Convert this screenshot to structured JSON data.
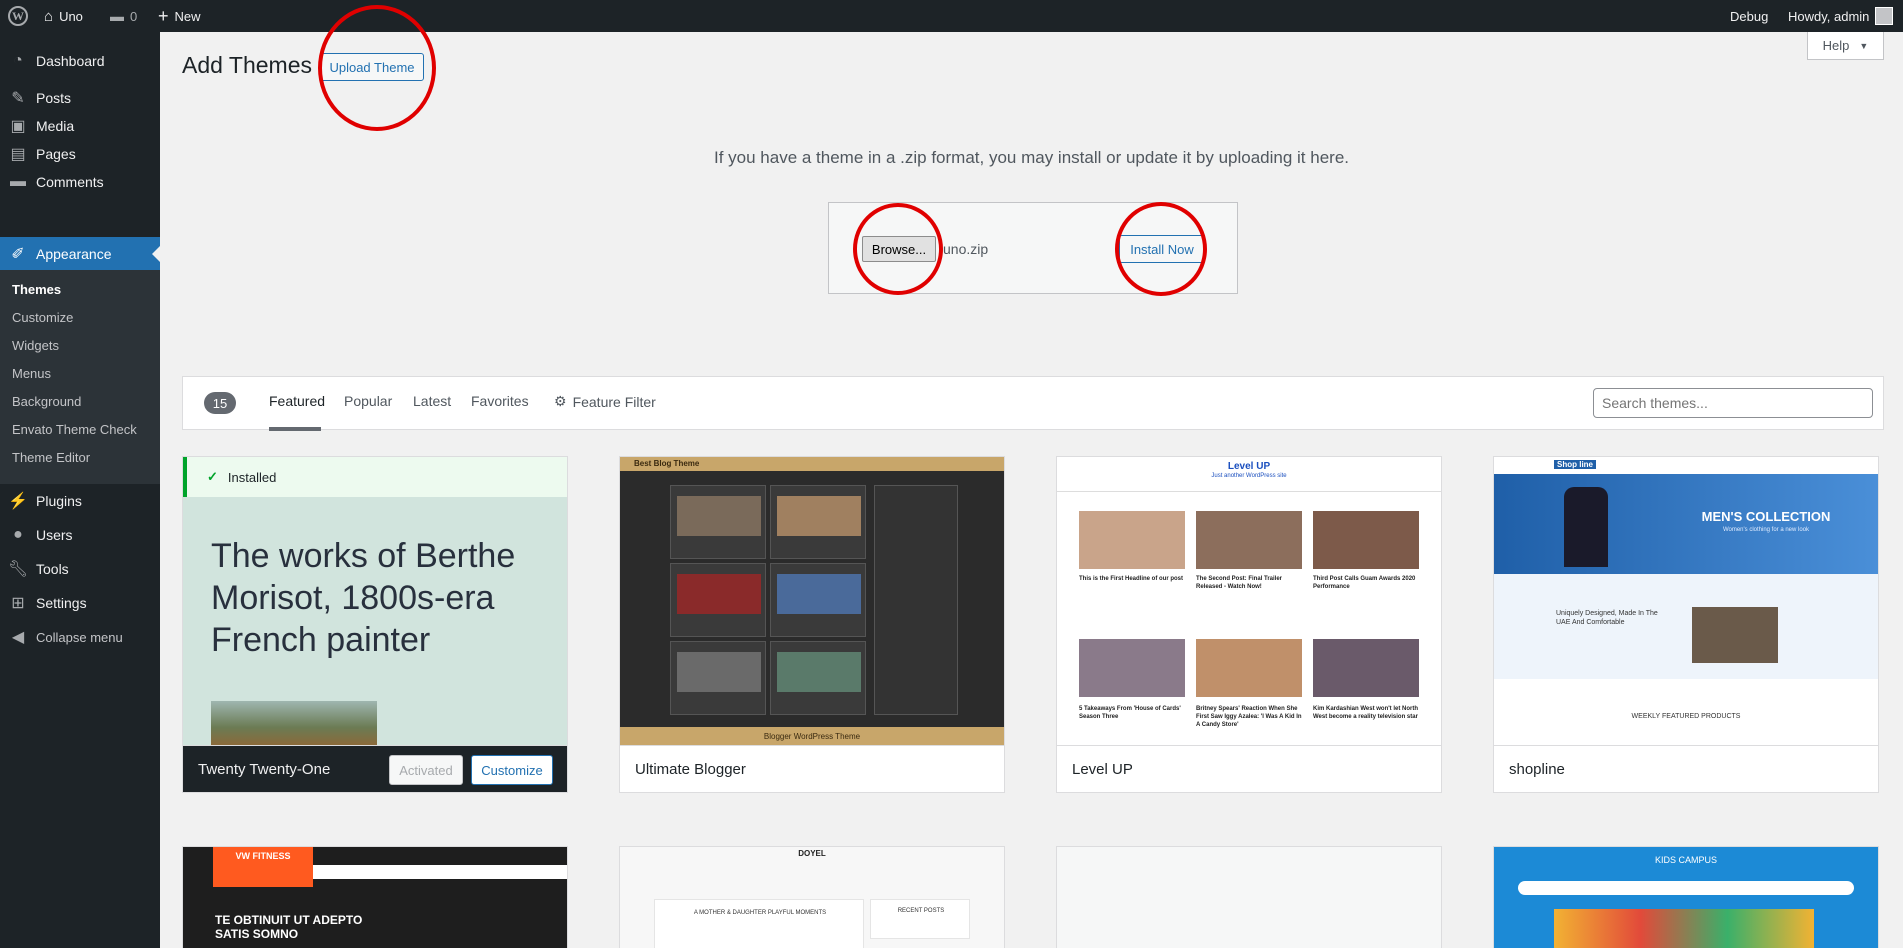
{
  "admin_bar": {
    "site_name": "Uno",
    "comments_count": "0",
    "new_label": "New",
    "debug_label": "Debug",
    "howdy": "Howdy, admin"
  },
  "sidebar": {
    "items": [
      {
        "label": "Dashboard",
        "icon": "dashboard-icon"
      },
      {
        "label": "Posts",
        "icon": "pin-icon"
      },
      {
        "label": "Media",
        "icon": "media-icon"
      },
      {
        "label": "Pages",
        "icon": "pages-icon"
      },
      {
        "label": "Comments",
        "icon": "comment-icon"
      },
      {
        "label": "Appearance",
        "icon": "brush-icon"
      },
      {
        "label": "Plugins",
        "icon": "plug-icon"
      },
      {
        "label": "Users",
        "icon": "user-icon"
      },
      {
        "label": "Tools",
        "icon": "wrench-icon"
      },
      {
        "label": "Settings",
        "icon": "settings-icon"
      },
      {
        "label": "Collapse menu",
        "icon": "collapse-icon"
      }
    ],
    "submenu": [
      "Themes",
      "Customize",
      "Widgets",
      "Menus",
      "Background",
      "Envato Theme Check",
      "Theme Editor"
    ]
  },
  "header": {
    "title": "Add Themes",
    "upload_button": "Upload Theme",
    "help": "Help"
  },
  "upload": {
    "description": "If you have a theme in a .zip format, you may install or update it by uploading it here.",
    "browse_label": "Browse...",
    "file_name": "uno.zip",
    "install_label": "Install Now"
  },
  "filter": {
    "count": "15",
    "tabs": [
      "Featured",
      "Popular",
      "Latest",
      "Favorites"
    ],
    "feature_filter": "Feature Filter",
    "search_placeholder": "Search themes..."
  },
  "themes": [
    {
      "name": "Twenty Twenty-One",
      "installed": "Installed",
      "headline": "The works of Berthe Morisot, 1800s-era French painter",
      "activated": "Activated",
      "customize": "Customize"
    },
    {
      "name": "Ultimate Blogger",
      "shot_title": "Best Blog Theme",
      "footer": "Blogger WordPress Theme"
    },
    {
      "name": "Level UP",
      "shot_title": "Level UP",
      "shot_subtitle": "Just another WordPress site",
      "posts": [
        "This is the First Headline of our post",
        "The Second Post: Final Trailer Released - Watch Now!",
        "Third Post Calls Guam Awards 2020 Performance",
        "5 Takeaways From 'House of Cards' Season Three",
        "Britney Spears' Reaction When She First Saw Iggy Azalea: 'I Was A Kid In A Candy Store'",
        "Kim Kardashian West won't let North West become a reality television star"
      ]
    },
    {
      "name": "shopline",
      "brand": "Shop line",
      "hero": "MEN'S COLLECTION",
      "hero_sub": "Women's clothing for a new look",
      "section": "Uniquely Designed, Made In The UAE And Comfortable",
      "featured": "WEEKLY FEATURED PRODUCTS"
    }
  ],
  "themes_row2": [
    {
      "brand": "VW FITNESS",
      "headline": "TE OBTINUIT UT ADEPTO SATIS SOMNO"
    },
    {
      "brand": "DOYEL",
      "post_title": "A MOTHER & DAUGHTER PLAYFUL MOMENTS",
      "recent": "RECENT POSTS"
    },
    {},
    {
      "brand": "KIDS CAMPUS"
    }
  ],
  "colors": {
    "admin_dark": "#1d2327",
    "accent_blue": "#2271b1",
    "annotation_red": "#e00000",
    "installed_green": "#00a32a"
  }
}
